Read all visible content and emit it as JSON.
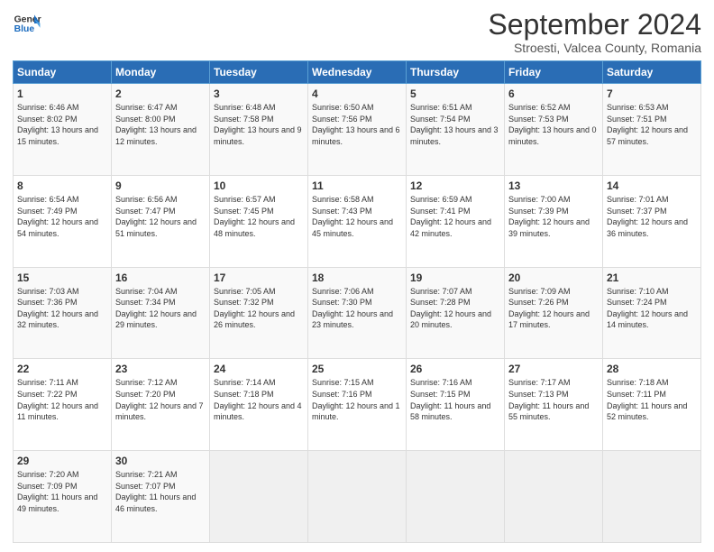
{
  "header": {
    "logo_line1": "General",
    "logo_line2": "Blue",
    "title": "September 2024",
    "subtitle": "Stroesti, Valcea County, Romania"
  },
  "weekdays": [
    "Sunday",
    "Monday",
    "Tuesday",
    "Wednesday",
    "Thursday",
    "Friday",
    "Saturday"
  ],
  "weeks": [
    [
      {
        "day": "1",
        "sunrise": "6:46 AM",
        "sunset": "8:02 PM",
        "daylight": "13 hours and 15 minutes."
      },
      {
        "day": "2",
        "sunrise": "6:47 AM",
        "sunset": "8:00 PM",
        "daylight": "13 hours and 12 minutes."
      },
      {
        "day": "3",
        "sunrise": "6:48 AM",
        "sunset": "7:58 PM",
        "daylight": "13 hours and 9 minutes."
      },
      {
        "day": "4",
        "sunrise": "6:50 AM",
        "sunset": "7:56 PM",
        "daylight": "13 hours and 6 minutes."
      },
      {
        "day": "5",
        "sunrise": "6:51 AM",
        "sunset": "7:54 PM",
        "daylight": "13 hours and 3 minutes."
      },
      {
        "day": "6",
        "sunrise": "6:52 AM",
        "sunset": "7:53 PM",
        "daylight": "13 hours and 0 minutes."
      },
      {
        "day": "7",
        "sunrise": "6:53 AM",
        "sunset": "7:51 PM",
        "daylight": "12 hours and 57 minutes."
      }
    ],
    [
      {
        "day": "8",
        "sunrise": "6:54 AM",
        "sunset": "7:49 PM",
        "daylight": "12 hours and 54 minutes."
      },
      {
        "day": "9",
        "sunrise": "6:56 AM",
        "sunset": "7:47 PM",
        "daylight": "12 hours and 51 minutes."
      },
      {
        "day": "10",
        "sunrise": "6:57 AM",
        "sunset": "7:45 PM",
        "daylight": "12 hours and 48 minutes."
      },
      {
        "day": "11",
        "sunrise": "6:58 AM",
        "sunset": "7:43 PM",
        "daylight": "12 hours and 45 minutes."
      },
      {
        "day": "12",
        "sunrise": "6:59 AM",
        "sunset": "7:41 PM",
        "daylight": "12 hours and 42 minutes."
      },
      {
        "day": "13",
        "sunrise": "7:00 AM",
        "sunset": "7:39 PM",
        "daylight": "12 hours and 39 minutes."
      },
      {
        "day": "14",
        "sunrise": "7:01 AM",
        "sunset": "7:37 PM",
        "daylight": "12 hours and 36 minutes."
      }
    ],
    [
      {
        "day": "15",
        "sunrise": "7:03 AM",
        "sunset": "7:36 PM",
        "daylight": "12 hours and 32 minutes."
      },
      {
        "day": "16",
        "sunrise": "7:04 AM",
        "sunset": "7:34 PM",
        "daylight": "12 hours and 29 minutes."
      },
      {
        "day": "17",
        "sunrise": "7:05 AM",
        "sunset": "7:32 PM",
        "daylight": "12 hours and 26 minutes."
      },
      {
        "day": "18",
        "sunrise": "7:06 AM",
        "sunset": "7:30 PM",
        "daylight": "12 hours and 23 minutes."
      },
      {
        "day": "19",
        "sunrise": "7:07 AM",
        "sunset": "7:28 PM",
        "daylight": "12 hours and 20 minutes."
      },
      {
        "day": "20",
        "sunrise": "7:09 AM",
        "sunset": "7:26 PM",
        "daylight": "12 hours and 17 minutes."
      },
      {
        "day": "21",
        "sunrise": "7:10 AM",
        "sunset": "7:24 PM",
        "daylight": "12 hours and 14 minutes."
      }
    ],
    [
      {
        "day": "22",
        "sunrise": "7:11 AM",
        "sunset": "7:22 PM",
        "daylight": "12 hours and 11 minutes."
      },
      {
        "day": "23",
        "sunrise": "7:12 AM",
        "sunset": "7:20 PM",
        "daylight": "12 hours and 7 minutes."
      },
      {
        "day": "24",
        "sunrise": "7:14 AM",
        "sunset": "7:18 PM",
        "daylight": "12 hours and 4 minutes."
      },
      {
        "day": "25",
        "sunrise": "7:15 AM",
        "sunset": "7:16 PM",
        "daylight": "12 hours and 1 minute."
      },
      {
        "day": "26",
        "sunrise": "7:16 AM",
        "sunset": "7:15 PM",
        "daylight": "11 hours and 58 minutes."
      },
      {
        "day": "27",
        "sunrise": "7:17 AM",
        "sunset": "7:13 PM",
        "daylight": "11 hours and 55 minutes."
      },
      {
        "day": "28",
        "sunrise": "7:18 AM",
        "sunset": "7:11 PM",
        "daylight": "11 hours and 52 minutes."
      }
    ],
    [
      {
        "day": "29",
        "sunrise": "7:20 AM",
        "sunset": "7:09 PM",
        "daylight": "11 hours and 49 minutes."
      },
      {
        "day": "30",
        "sunrise": "7:21 AM",
        "sunset": "7:07 PM",
        "daylight": "11 hours and 46 minutes."
      },
      null,
      null,
      null,
      null,
      null
    ]
  ]
}
